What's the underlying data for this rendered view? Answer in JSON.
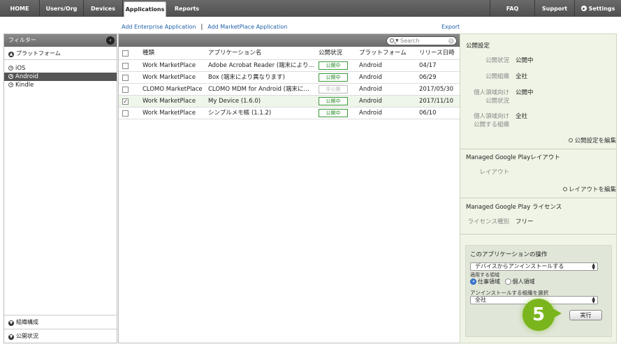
{
  "nav": {
    "tabs": [
      "HOME",
      "Users/Org",
      "Devices",
      "Applications",
      "Reports"
    ],
    "active": "Applications",
    "right": {
      "faq": "FAQ",
      "support": "Support",
      "settings": "Settings"
    }
  },
  "actions": {
    "add_enterprise": "Add Enterprise Application",
    "separator": "|",
    "add_marketplace": "Add MarketPlace Application",
    "export": "Export"
  },
  "filter": {
    "title": "フィルター",
    "platform_group": "プラットフォーム",
    "platforms": [
      "iOS",
      "Android",
      "Kindle"
    ],
    "selected_platform": "Android",
    "bottom_groups": [
      "組織構成",
      "公開状況"
    ]
  },
  "search": {
    "placeholder": "Search"
  },
  "table": {
    "headers": [
      "種類",
      "アプリケーション名",
      "公開状況",
      "プラットフォーム",
      "リリース日時"
    ],
    "rows": [
      {
        "type": "Work MarketPlace",
        "name": "Adobe Acrobat Reader (端末により...",
        "status": "公開中",
        "status_on": true,
        "platform": "Android",
        "date": "04/17",
        "checked": false
      },
      {
        "type": "Work MarketPlace",
        "name": "Box (端末により異なります)",
        "status": "公開中",
        "status_on": true,
        "platform": "Android",
        "date": "06/29",
        "checked": false
      },
      {
        "type": "CLOMO MarketPlace",
        "name": "CLOMO MDM for Android (端末によ...",
        "status": "非公開",
        "status_on": false,
        "platform": "Android",
        "date": "2017/05/30",
        "checked": false
      },
      {
        "type": "Work MarketPlace",
        "name": "My Device (1.6.0)",
        "status": "公開中",
        "status_on": true,
        "platform": "Android",
        "date": "2017/11/10",
        "checked": true
      },
      {
        "type": "Work MarketPlace",
        "name": "シンプルメモ帳 (1.1.2)",
        "status": "公開中",
        "status_on": true,
        "platform": "Android",
        "date": "06/10",
        "checked": false
      }
    ]
  },
  "publish": {
    "title": "公開設定",
    "status_label": "公開状況",
    "status_value": "公開中",
    "org_label": "公開組織",
    "org_value": "全社",
    "personal_status_label_1": "個人領域向け",
    "personal_status_label_2": "公開状況",
    "personal_status_value": "公開中",
    "personal_org_label_1": "個人領域向け",
    "personal_org_label_2": "公開する組織",
    "personal_org_value": "全社",
    "edit_link": "公開設定を編集"
  },
  "layout_section": {
    "title": "Managed Google Playレイアウト",
    "label": "レイアウト",
    "edit_link": "レイアウトを編集"
  },
  "license_section": {
    "title": "Managed Google Play ライセンス",
    "label": "ライセンス種別",
    "value": "フリー"
  },
  "operations": {
    "title": "このアプリケーションの操作",
    "action_select": "デバイスからアンインストールする",
    "scope_label": "適用する領域",
    "scope_work": "仕事領域",
    "scope_personal": "個人領域",
    "org_label": "アンインストールする組織を選択",
    "org_select": "全社",
    "execute": "実行"
  },
  "step_number": "5",
  "colors": {
    "accent_green": "#7ab51d",
    "status_green": "#2a8a2a",
    "panel_bg": "#eff4e6",
    "radio_blue": "#3a7ad8"
  }
}
